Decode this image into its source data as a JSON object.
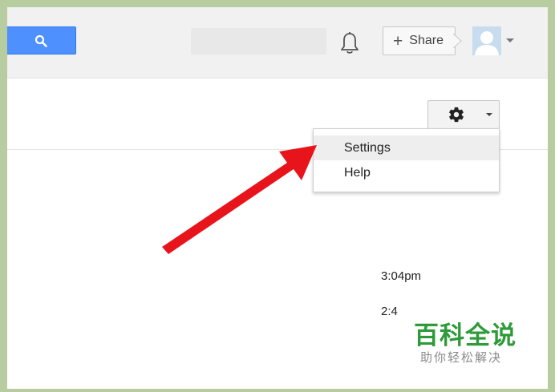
{
  "header": {
    "search_icon": "magnifier-icon",
    "notifications_icon": "bell-icon",
    "share_icon": "plus-icon",
    "share_label": "Share",
    "avatar_icon": "default-avatar-icon"
  },
  "toolbar": {
    "gear_icon": "gear-icon",
    "dropdown_icon": "caret-down-icon"
  },
  "settings_menu": {
    "items": [
      {
        "label": "Settings",
        "highlighted": true
      },
      {
        "label": "Help",
        "highlighted": false
      }
    ]
  },
  "email_list": {
    "times": [
      "3:04pm",
      "2:4"
    ]
  },
  "annotation": {
    "arrow_color": "#e8141b"
  },
  "watermark": {
    "title": "百科全说",
    "subtitle": "助你轻松解决"
  },
  "colors": {
    "accent_blue": "#4d90fe",
    "watermark_green": "#2e9a3a",
    "frame_border": "#b7cc9f"
  }
}
